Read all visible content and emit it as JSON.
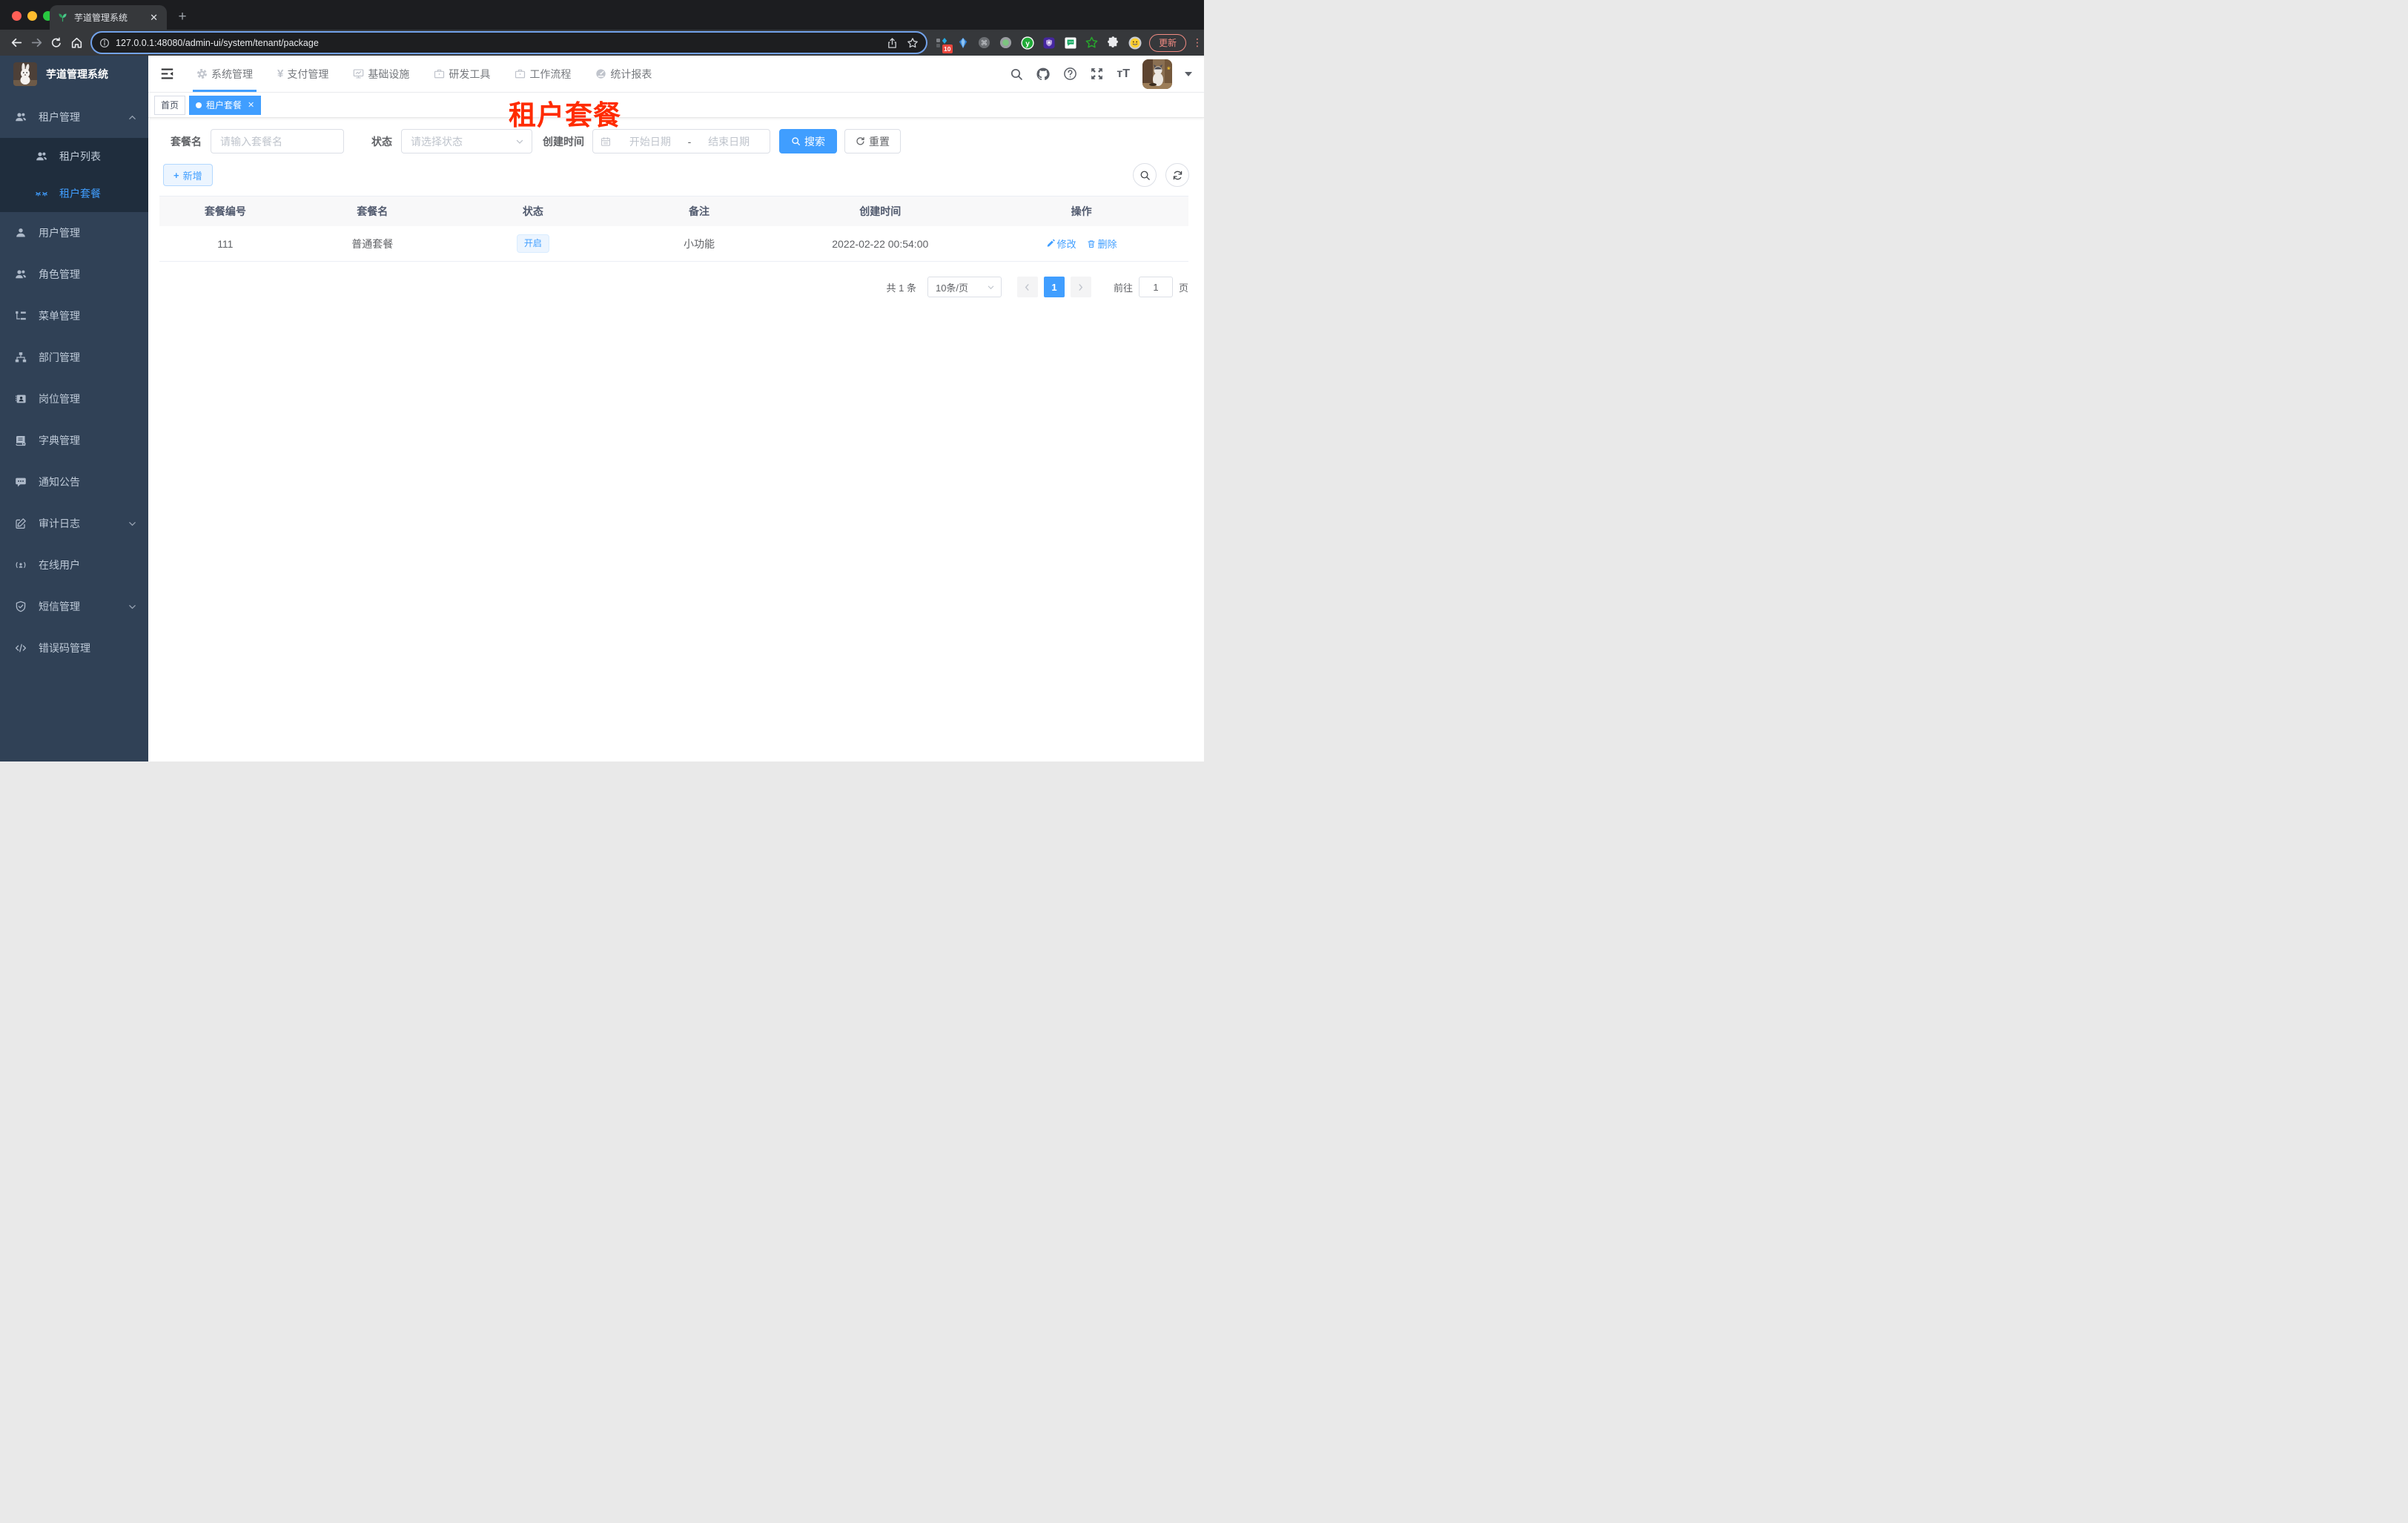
{
  "browser": {
    "tab_title": "芋道管理系统",
    "tab_close": "✕",
    "new_tab": "+",
    "url": "127.0.0.1:48080/admin-ui/system/tenant/package",
    "ext_badge": "10",
    "update_label": "更新",
    "menu_dots": "⋮"
  },
  "sidebar": {
    "title": "芋道管理系统",
    "items": [
      {
        "label": "租户管理",
        "icon": "users-icon"
      },
      {
        "label": "租户列表",
        "icon": "users-icon"
      },
      {
        "label": "租户套餐",
        "icon": "eyes-icon"
      },
      {
        "label": "用户管理",
        "icon": "user-icon"
      },
      {
        "label": "角色管理",
        "icon": "people-icon"
      },
      {
        "label": "菜单管理",
        "icon": "tree-icon"
      },
      {
        "label": "部门管理",
        "icon": "org-icon"
      },
      {
        "label": "岗位管理",
        "icon": "badge-icon"
      },
      {
        "label": "字典管理",
        "icon": "dict-icon"
      },
      {
        "label": "通知公告",
        "icon": "message-icon"
      },
      {
        "label": "审计日志",
        "icon": "edit-icon"
      },
      {
        "label": "在线用户",
        "icon": "online-icon"
      },
      {
        "label": "短信管理",
        "icon": "shield-icon"
      },
      {
        "label": "错误码管理",
        "icon": "code-icon"
      }
    ]
  },
  "topnav": {
    "items": [
      {
        "label": "系统管理",
        "icon": "gear-icon"
      },
      {
        "label": "支付管理",
        "icon": "yen-icon",
        "glyph": "¥"
      },
      {
        "label": "基础设施",
        "icon": "monitor-icon"
      },
      {
        "label": "研发工具",
        "icon": "briefcase-icon"
      },
      {
        "label": "工作流程",
        "icon": "briefcase-icon"
      },
      {
        "label": "统计报表",
        "icon": "dashboard-icon"
      }
    ]
  },
  "tags": {
    "home": "首页",
    "active": "租户套餐",
    "close": "✕"
  },
  "annotation": "租户套餐",
  "filters": {
    "name_label": "套餐名",
    "name_placeholder": "请输入套餐名",
    "status_label": "状态",
    "status_placeholder": "请选择状态",
    "date_label": "创建时间",
    "date_start": "开始日期",
    "date_sep": "-",
    "date_end": "结束日期",
    "search_label": "搜索",
    "reset_label": "重置"
  },
  "toolbar": {
    "add_label": "新增",
    "plus": "+"
  },
  "table": {
    "headers": [
      "套餐编号",
      "套餐名",
      "状态",
      "备注",
      "创建时间",
      "操作"
    ],
    "row": {
      "id": "111",
      "name": "普通套餐",
      "status": "开启",
      "remark": "小功能",
      "created": "2022-02-22 00:54:00",
      "edit_label": "修改",
      "delete_label": "删除"
    }
  },
  "pagination": {
    "total": "共 1 条",
    "page_size": "10条/页",
    "page": "1",
    "goto_label": "前往",
    "goto_value": "1",
    "page_unit": "页"
  },
  "colors": {
    "accent": "#409eff",
    "annotation_red": "#ff2b00",
    "sidebar_bg": "#304156",
    "submenu_bg": "#1f2d3d",
    "status_tag_bg": "#ecf5ff",
    "update_red": "#f28b82"
  }
}
